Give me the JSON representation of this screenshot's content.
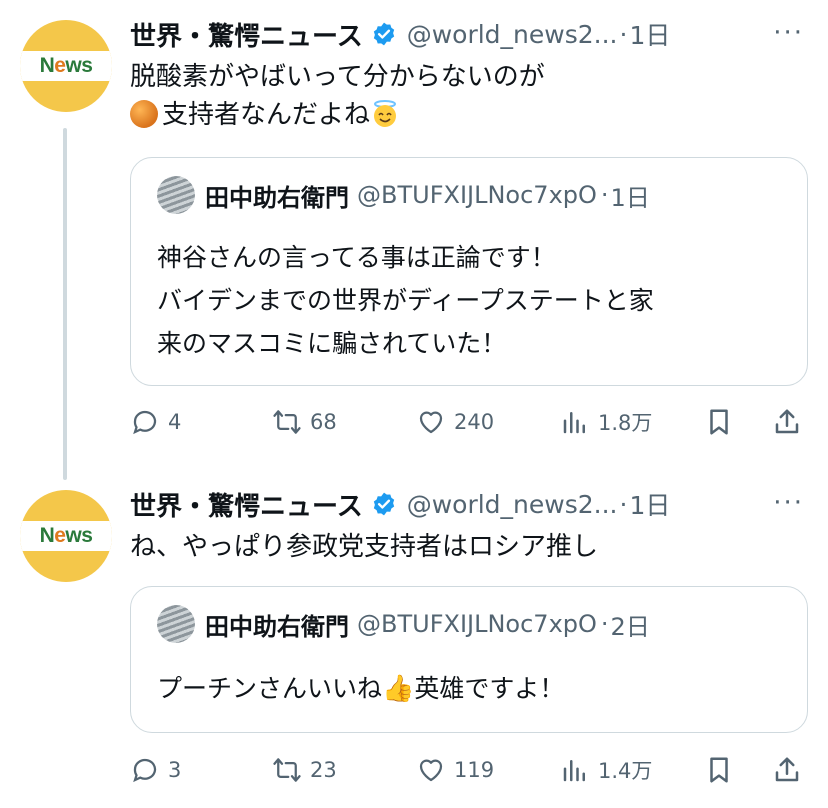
{
  "tweets": [
    {
      "author": {
        "name": "世界・驚愕ニュース",
        "handle": "@world_news2...",
        "avatar_text_a": "N",
        "avatar_text_o": "e",
        "avatar_text_b": "ws"
      },
      "time": "1日",
      "more": "···",
      "text_line1": "脱酸素がやばいって分からないのが",
      "text_line2": "支持者なんだよね",
      "emoji_orange": "orange-circle",
      "emoji_halo": "smiling-face-with-halo",
      "quote": {
        "name": "田中助右衛門",
        "handle": "@BTUFXIJLNoc7xpO",
        "time": "1日",
        "lines": [
          "神谷さんの言ってる事は正論です！",
          "バイデンまでの世界がディープステートと家",
          "来のマスコミに騙されていた！"
        ]
      },
      "stats": {
        "replies": "4",
        "reposts": "68",
        "likes": "240",
        "views": "1.8万"
      }
    },
    {
      "author": {
        "name": "世界・驚愕ニュース",
        "handle": "@world_news2...",
        "avatar_text_a": "N",
        "avatar_text_o": "e",
        "avatar_text_b": "ws"
      },
      "time": "1日",
      "more": "···",
      "text_line1": "ね、やっぱり参政党支持者はロシア推し",
      "quote": {
        "name": "田中助右衛門",
        "handle": "@BTUFXIJLNoc7xpO",
        "time": "2日",
        "line_before": "プーチンさんいいね",
        "emoji": "👍",
        "line_after": "英雄ですよ！"
      },
      "stats": {
        "replies": "3",
        "reposts": "23",
        "likes": "119",
        "views": "1.4万"
      }
    }
  ],
  "colors": {
    "text": "#0f1419",
    "muted": "#536471",
    "border": "#cfd9de",
    "verified": "#1d9bf0",
    "avatar_bg": "#f4c74a"
  }
}
